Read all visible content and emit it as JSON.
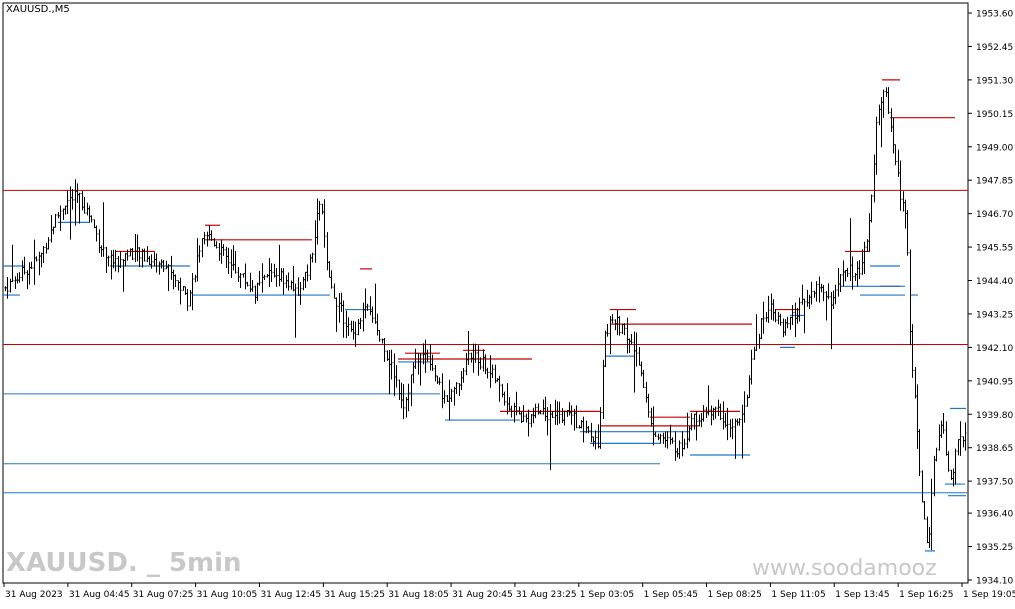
{
  "symbol": "XAUUSD.,M5",
  "watermark_left": "XAUUSD. _ 5min",
  "watermark_right": "www.soodamooz",
  "colors": {
    "background": "#ffffff",
    "candle": "#000000",
    "resistance": "#c80000",
    "support": "#1e78c8",
    "grid_text": "#000000"
  },
  "chart_data": {
    "type": "candlestick",
    "title": "XAUUSD.,M5",
    "ylim": [
      1934.1,
      1953.6
    ],
    "y_ticks": [
      "1953.60",
      "1952.45",
      "1951.30",
      "1950.15",
      "1949.00",
      "1947.85",
      "1946.70",
      "1945.55",
      "1944.40",
      "1943.25",
      "1942.10",
      "1940.95",
      "1939.80",
      "1938.65",
      "1937.50",
      "1936.40",
      "1935.25",
      "1934.10"
    ],
    "x_ticks": [
      "31 Aug 2023",
      "31 Aug 04:45",
      "31 Aug 07:25",
      "31 Aug 10:05",
      "31 Aug 12:45",
      "31 Aug 15:25",
      "31 Aug 18:05",
      "31 Aug 20:45",
      "31 Aug 23:25",
      "1 Sep 03:05",
      "1 Sep 05:45",
      "1 Sep 08:25",
      "1 Sep 11:05",
      "1 Sep 13:45",
      "1 Sep 16:25",
      "1 Sep 19:05"
    ],
    "levels": {
      "resistance_full": [
        1947.5,
        1942.2
      ],
      "support_full": [
        1940.5,
        1938.1,
        1937.1
      ]
    },
    "price_path": [
      [
        0,
        1944.0
      ],
      [
        20,
        1944.6
      ],
      [
        40,
        1945.2
      ],
      [
        55,
        1946.5
      ],
      [
        65,
        1947.1
      ],
      [
        78,
        1947.3
      ],
      [
        90,
        1946.6
      ],
      [
        100,
        1945.6
      ],
      [
        115,
        1945.0
      ],
      [
        130,
        1945.4
      ],
      [
        150,
        1945.1
      ],
      [
        170,
        1944.8
      ],
      [
        188,
        1943.7
      ],
      [
        200,
        1945.6
      ],
      [
        210,
        1945.9
      ],
      [
        225,
        1945.2
      ],
      [
        240,
        1944.6
      ],
      [
        255,
        1944.0
      ],
      [
        270,
        1944.7
      ],
      [
        285,
        1944.5
      ],
      [
        300,
        1944.0
      ],
      [
        312,
        1945.2
      ],
      [
        320,
        1947.3
      ],
      [
        328,
        1944.4
      ],
      [
        340,
        1943.4
      ],
      [
        352,
        1942.5
      ],
      [
        365,
        1943.5
      ],
      [
        378,
        1942.6
      ],
      [
        392,
        1941.4
      ],
      [
        404,
        1940.1
      ],
      [
        415,
        1941.7
      ],
      [
        428,
        1941.9
      ],
      [
        443,
        1940.3
      ],
      [
        455,
        1940.6
      ],
      [
        468,
        1941.8
      ],
      [
        482,
        1941.6
      ],
      [
        495,
        1941.0
      ],
      [
        510,
        1940.0
      ],
      [
        525,
        1939.6
      ],
      [
        540,
        1939.9
      ],
      [
        555,
        1939.7
      ],
      [
        570,
        1939.8
      ],
      [
        585,
        1939.2
      ],
      [
        598,
        1938.7
      ],
      [
        605,
        1942.7
      ],
      [
        615,
        1943.0
      ],
      [
        628,
        1942.4
      ],
      [
        640,
        1941.6
      ],
      [
        650,
        1939.4
      ],
      [
        665,
        1938.9
      ],
      [
        680,
        1938.6
      ],
      [
        692,
        1939.6
      ],
      [
        705,
        1939.8
      ],
      [
        718,
        1939.9
      ],
      [
        730,
        1939.3
      ],
      [
        742,
        1939.6
      ],
      [
        752,
        1941.6
      ],
      [
        762,
        1943.1
      ],
      [
        772,
        1943.6
      ],
      [
        782,
        1942.6
      ],
      [
        795,
        1943.2
      ],
      [
        808,
        1943.9
      ],
      [
        820,
        1944.2
      ],
      [
        832,
        1943.7
      ],
      [
        845,
        1944.8
      ],
      [
        858,
        1944.6
      ],
      [
        868,
        1945.8
      ],
      [
        876,
        1949.6
      ],
      [
        884,
        1951.1
      ],
      [
        892,
        1949.3
      ],
      [
        900,
        1947.4
      ],
      [
        906,
        1946.8
      ],
      [
        910,
        1942.6
      ],
      [
        916,
        1939.5
      ],
      [
        922,
        1936.8
      ],
      [
        928,
        1935.2
      ],
      [
        935,
        1938.6
      ],
      [
        942,
        1939.4
      ],
      [
        950,
        1937.4
      ],
      [
        958,
        1938.9
      ],
      [
        967,
        1939.0
      ]
    ]
  }
}
